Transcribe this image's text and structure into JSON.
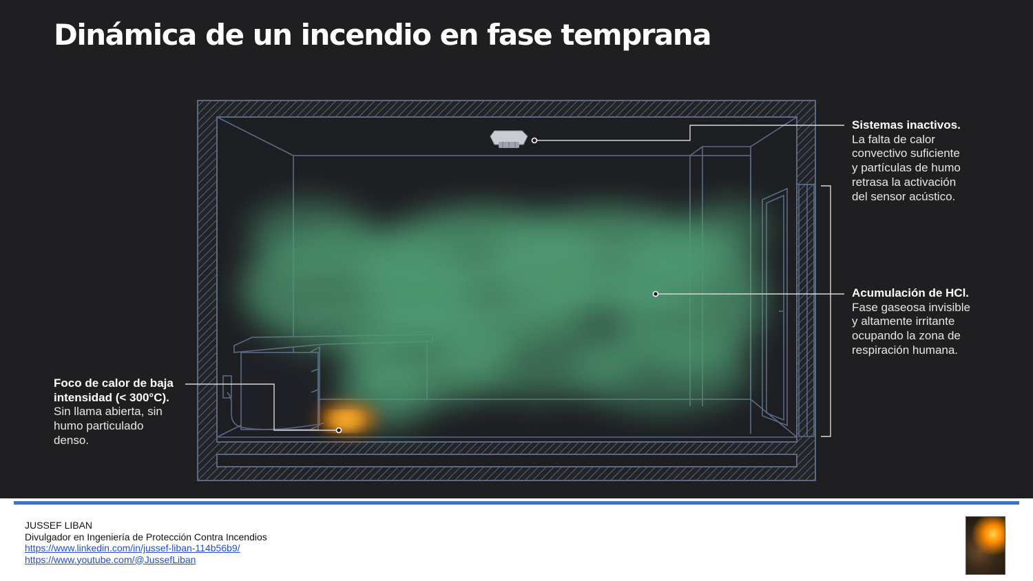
{
  "title": "Dinámica de un incendio en fase temprana",
  "callouts": {
    "sistemas": {
      "heading": "Sistemas inactivos.",
      "body": "La falta de calor\nconvectivo suficiente\ny partículas de humo\nretrasa la activación\ndel sensor acústico."
    },
    "hcl": {
      "heading": "Acumulación de HCl.",
      "body": "Fase gaseosa invisible\ny altamente irritante\nocupando la zona de\nrespiración humana."
    },
    "foco": {
      "heading": "Foco de calor de baja\nintensidad (< 300°C).",
      "body": "Sin llama abierta, sin\nhumo particulado\ndenso."
    }
  },
  "colors": {
    "background": "#1f1f21",
    "structure_lines": "#5a6a86",
    "gas_cloud": "#4f9a72",
    "heat_source": "#ff9a1a",
    "footer_rule": "#4472c4"
  },
  "footer": {
    "name": "JUSSEF LIBAN",
    "role": "Divulgador en Ingeniería de Protección Contra Incendios",
    "links": [
      "https://www.linkedin.com/in/jussef-liban-114b56b9/",
      "https://www.youtube.com/@JussefLiban"
    ]
  },
  "icons": {
    "smoke_detector": "smoke-detector-icon",
    "author_photo": "firefighter-avatar"
  }
}
